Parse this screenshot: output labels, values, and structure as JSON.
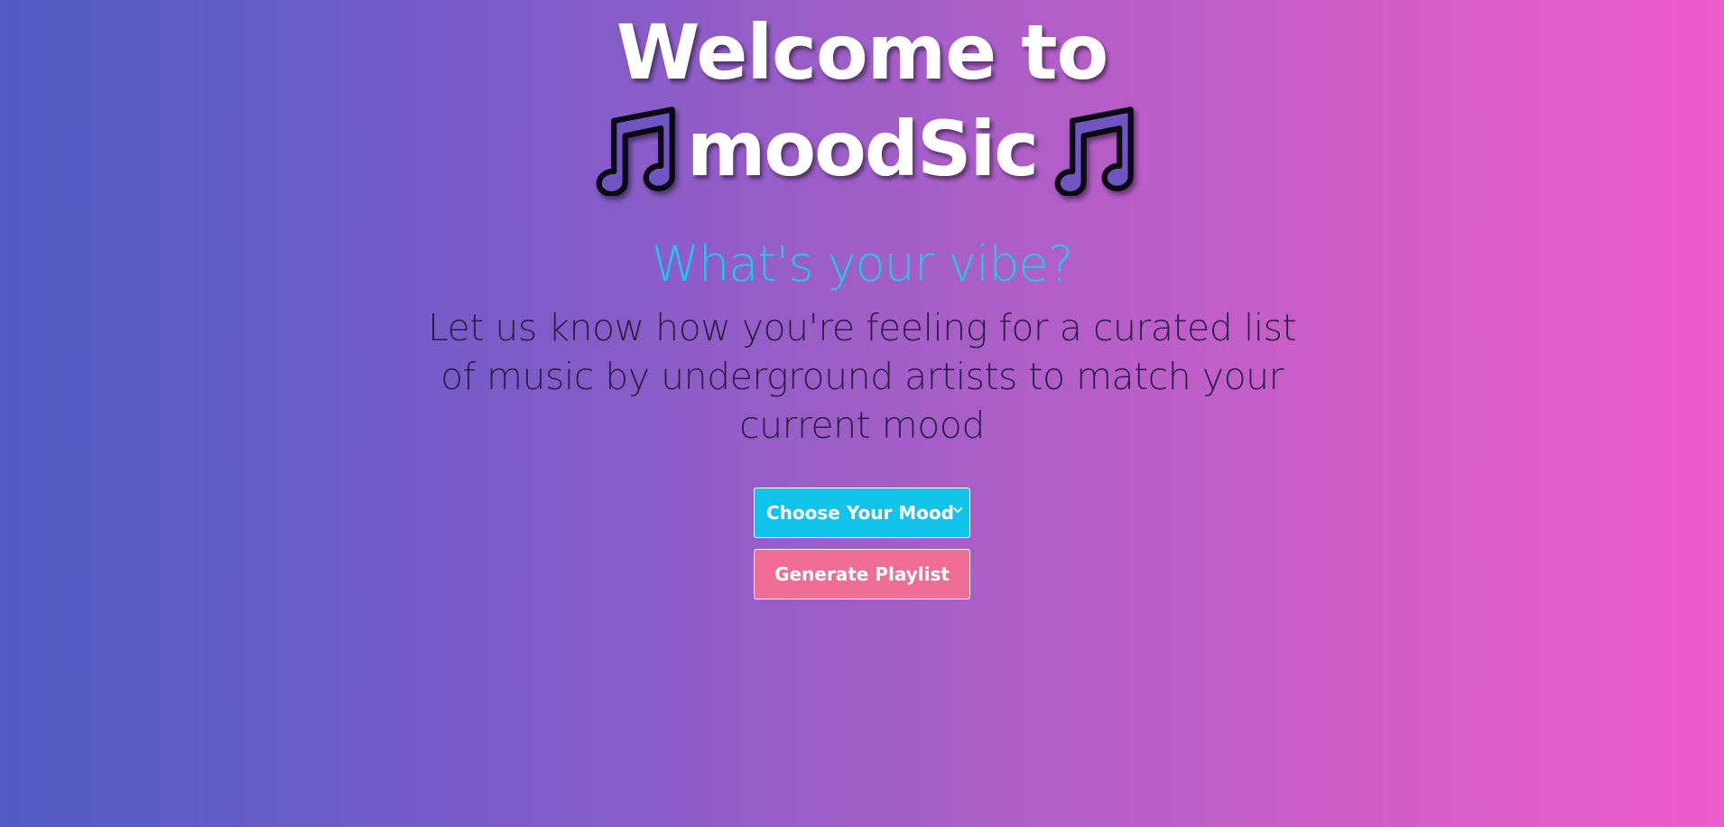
{
  "hero": {
    "title_line1": "Welcome to",
    "brand": "moodSic",
    "left_icon": "music-notes-icon",
    "right_icon": "music-notes-icon"
  },
  "subtitle": "What's your vibe?",
  "description": "Let us know how you're feeling for a curated list of music by underground artists to match your current mood",
  "mood_select": {
    "selected_label": "Choose Your Mood",
    "icon": "chevron-down-icon"
  },
  "generate_button": {
    "label": "Generate Playlist"
  },
  "colors": {
    "gradient_start": "#4f5cc4",
    "gradient_end": "#f05ccb",
    "subtitle": "#1ec8ea",
    "select_bg": "#12c4ea",
    "button_bg": "#f06d96",
    "note_fill": "#7055c3"
  }
}
